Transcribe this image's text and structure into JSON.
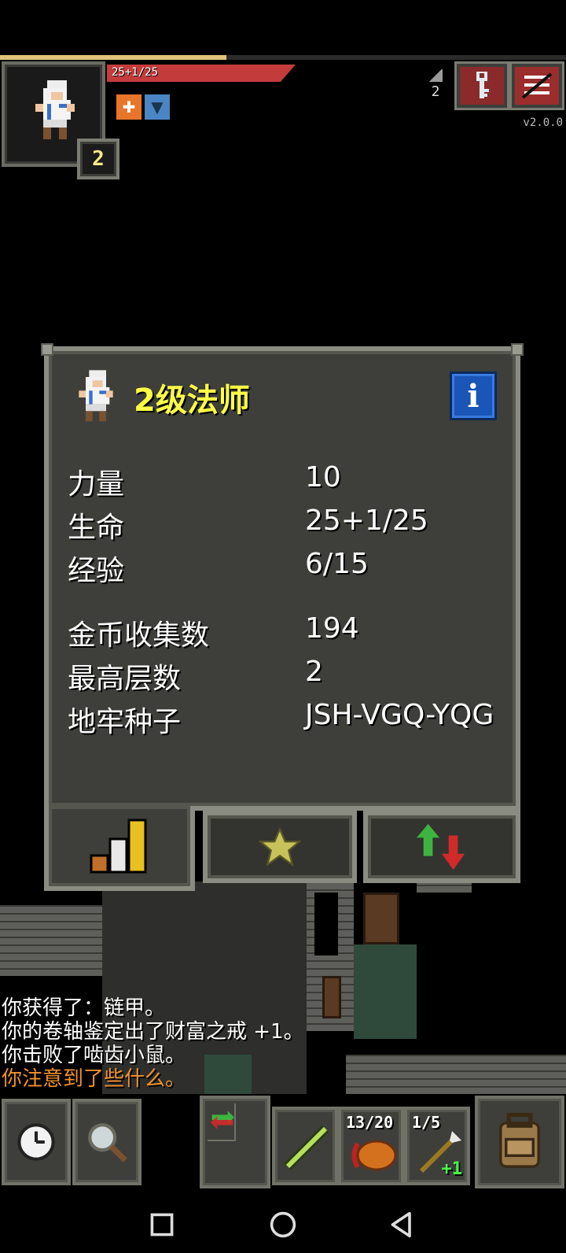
{
  "hud": {
    "xp_progress": 0.4,
    "hp_text": "25+1/25",
    "hp_progress": 1.0,
    "level": "2",
    "depth": "2",
    "version": "v2.0.0",
    "buffs": [
      {
        "icon": "shield-cross-icon"
      },
      {
        "icon": "armor-icon"
      }
    ],
    "buttons": [
      {
        "icon": "key-icon"
      },
      {
        "icon": "menu-icon"
      }
    ]
  },
  "window": {
    "title": "2级法师",
    "stats_primary": [
      {
        "label": "力量",
        "value": "10"
      },
      {
        "label": "生命",
        "value": "25+1/25"
      },
      {
        "label": "经验",
        "value": "6/15"
      }
    ],
    "stats_secondary": [
      {
        "label": "金币收集数",
        "value": "194"
      },
      {
        "label": "最高层数",
        "value": "2"
      },
      {
        "label": "地牢种子",
        "value": "JSH-VGQ-YQG"
      }
    ],
    "tabs": [
      {
        "icon": "stats-bars-icon"
      },
      {
        "icon": "star-icon"
      },
      {
        "icon": "up-down-arrows-icon"
      }
    ]
  },
  "log": [
    {
      "text": "你获得了：链甲。"
    },
    {
      "text": "你的卷轴鉴定出了财富之戒 +1。"
    },
    {
      "text": "你击败了啮齿小鼠。"
    },
    {
      "text": "你注意到了些什么。"
    }
  ],
  "toolbar": {
    "quickslots": [
      {
        "icon": "wand-icon",
        "label": "",
        "bonus": ""
      },
      {
        "icon": "ration-icon",
        "label": "13/20",
        "bonus": ""
      },
      {
        "icon": "spear-icon",
        "label": "1/5",
        "bonus": "+1"
      }
    ]
  },
  "colors": {
    "title": "#ffff44",
    "notice": "#f0912c",
    "hp": "#c43b3b",
    "panel": "#3e3f3a"
  }
}
